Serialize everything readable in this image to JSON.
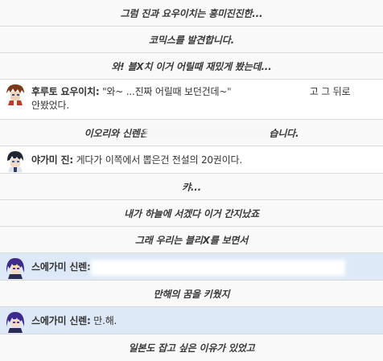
{
  "log": {
    "rows": [
      {
        "kind": "narration",
        "text": "그럼 진과 요우이치는 흥미진진한..."
      },
      {
        "kind": "narration",
        "text": "코믹스를 발견합니다."
      },
      {
        "kind": "narration",
        "text": "와! 블X치 이거 어릴때 재밌게 봤는데..."
      },
      {
        "kind": "speech",
        "speaker": "후루토 요우이치:",
        "text": "\"와~ ...진짜 어릴때 보던건데~\"",
        "text_tail": "고 그 뒤로",
        "line2": "안봤었다.",
        "avatar": "brown-hair-boy-avatar"
      },
      {
        "kind": "narration",
        "text": "이오리와 신렌은",
        "text_tail": "습니다."
      },
      {
        "kind": "speech",
        "speaker": "야가미 진:",
        "text": "게다가 이쪽에서 뽑은건 전설의 20권이다.",
        "avatar": "dark-hair-boy-avatar"
      },
      {
        "kind": "narration",
        "text": "캬..."
      },
      {
        "kind": "narration",
        "text": "내가 하늘에 서겠다 이거 간지났죠"
      },
      {
        "kind": "narration",
        "text": "그래 우리는 블리X를 보면서"
      },
      {
        "kind": "speech",
        "speaker": "스에가미 신렌:",
        "text": "",
        "avatar": "purple-hair-avatar",
        "highlight": true
      },
      {
        "kind": "narration",
        "text": "만해의 꿈을 키웠지"
      },
      {
        "kind": "speech",
        "speaker": "스에가미 신렌:",
        "text": "만.해.",
        "avatar": "purple-hair-avatar",
        "highlight": true
      },
      {
        "kind": "narration",
        "text": "일본도 잡고 싶은 이유가 있었고"
      }
    ]
  },
  "colors": {
    "narration_bg": "#f9f9f9",
    "speech_bg": "#ffffff",
    "speech_highlight_bg": "#dde9f6",
    "divider": "#dadada"
  }
}
